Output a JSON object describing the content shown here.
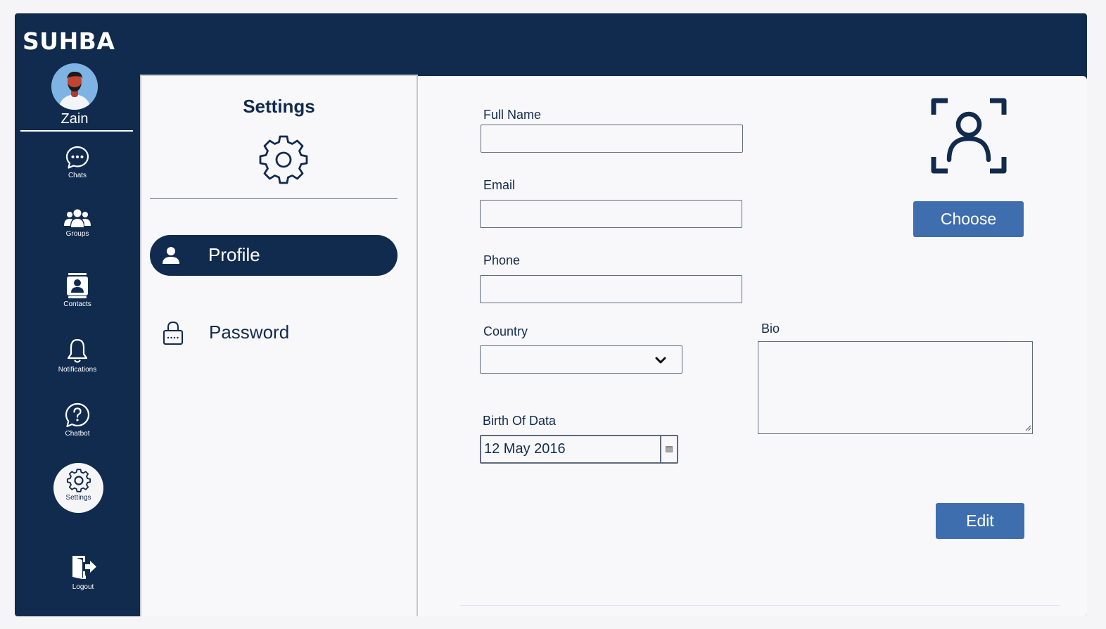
{
  "app": {
    "name": "SUHBA"
  },
  "user": {
    "name": "Zain"
  },
  "nav": {
    "chats": "Chats",
    "groups": "Groups",
    "contacts": "Contacts",
    "notifications": "Notifications",
    "chatbot": "Chatbot",
    "settings": "Settings",
    "logout": "Logout"
  },
  "settings_panel": {
    "title": "Settings",
    "menu": [
      {
        "label": "Profile",
        "icon": "person-icon",
        "active": true
      },
      {
        "label": "Password",
        "icon": "lock-icon",
        "active": false
      }
    ]
  },
  "form": {
    "full_name": {
      "label": "Full Name",
      "value": ""
    },
    "email": {
      "label": "Email",
      "value": ""
    },
    "phone": {
      "label": "Phone",
      "value": ""
    },
    "country": {
      "label": "Country",
      "value": ""
    },
    "birth_date": {
      "label": "Birth Of Data",
      "value": "12 May 2016"
    },
    "bio": {
      "label": "Bio",
      "value": ""
    }
  },
  "buttons": {
    "choose": "Choose",
    "edit": "Edit"
  },
  "colors": {
    "navy": "#112b4e",
    "button_blue": "#3e6eae",
    "background": "#f8f8fa"
  }
}
